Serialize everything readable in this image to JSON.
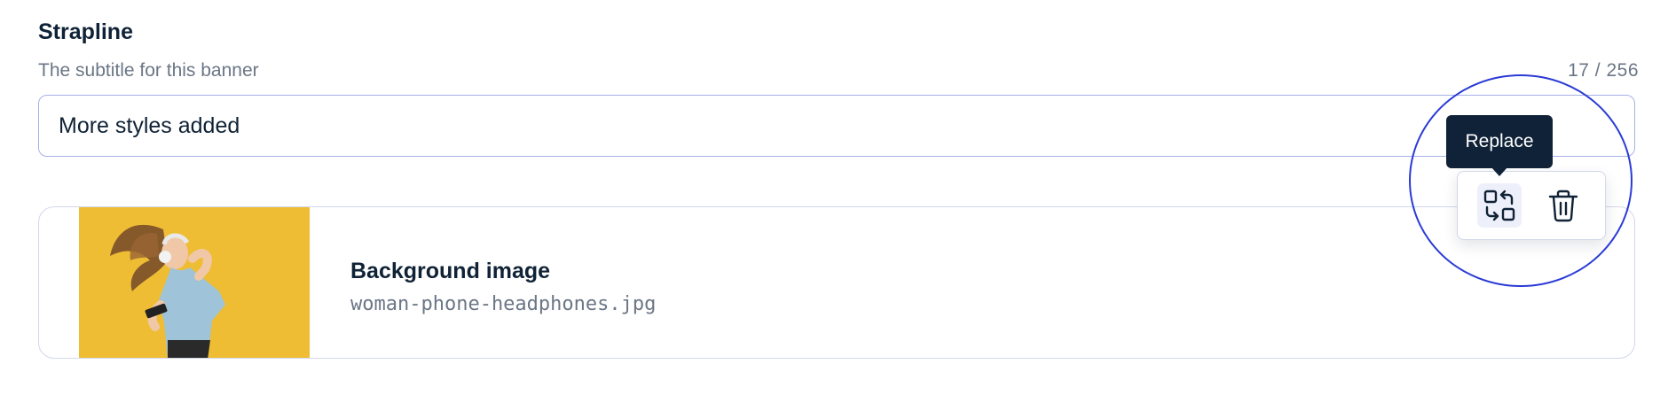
{
  "field": {
    "label": "Strapline",
    "help_text": "The subtitle for this banner",
    "char_count": "17 / 256",
    "value": "More styles added"
  },
  "media": {
    "title": "Background image",
    "filename": "woman-phone-headphones.jpg"
  },
  "toolbar": {
    "tooltip": "Replace",
    "replace_icon": "replace-icon",
    "delete_icon": "trash-icon"
  },
  "colors": {
    "text": "#0f2236",
    "muted": "#6b7686",
    "input_border": "#a7b2e6",
    "highlight_ring": "#2a3bd6",
    "tooltip_bg": "#102238",
    "thumb_bg": "#f2c43a"
  }
}
